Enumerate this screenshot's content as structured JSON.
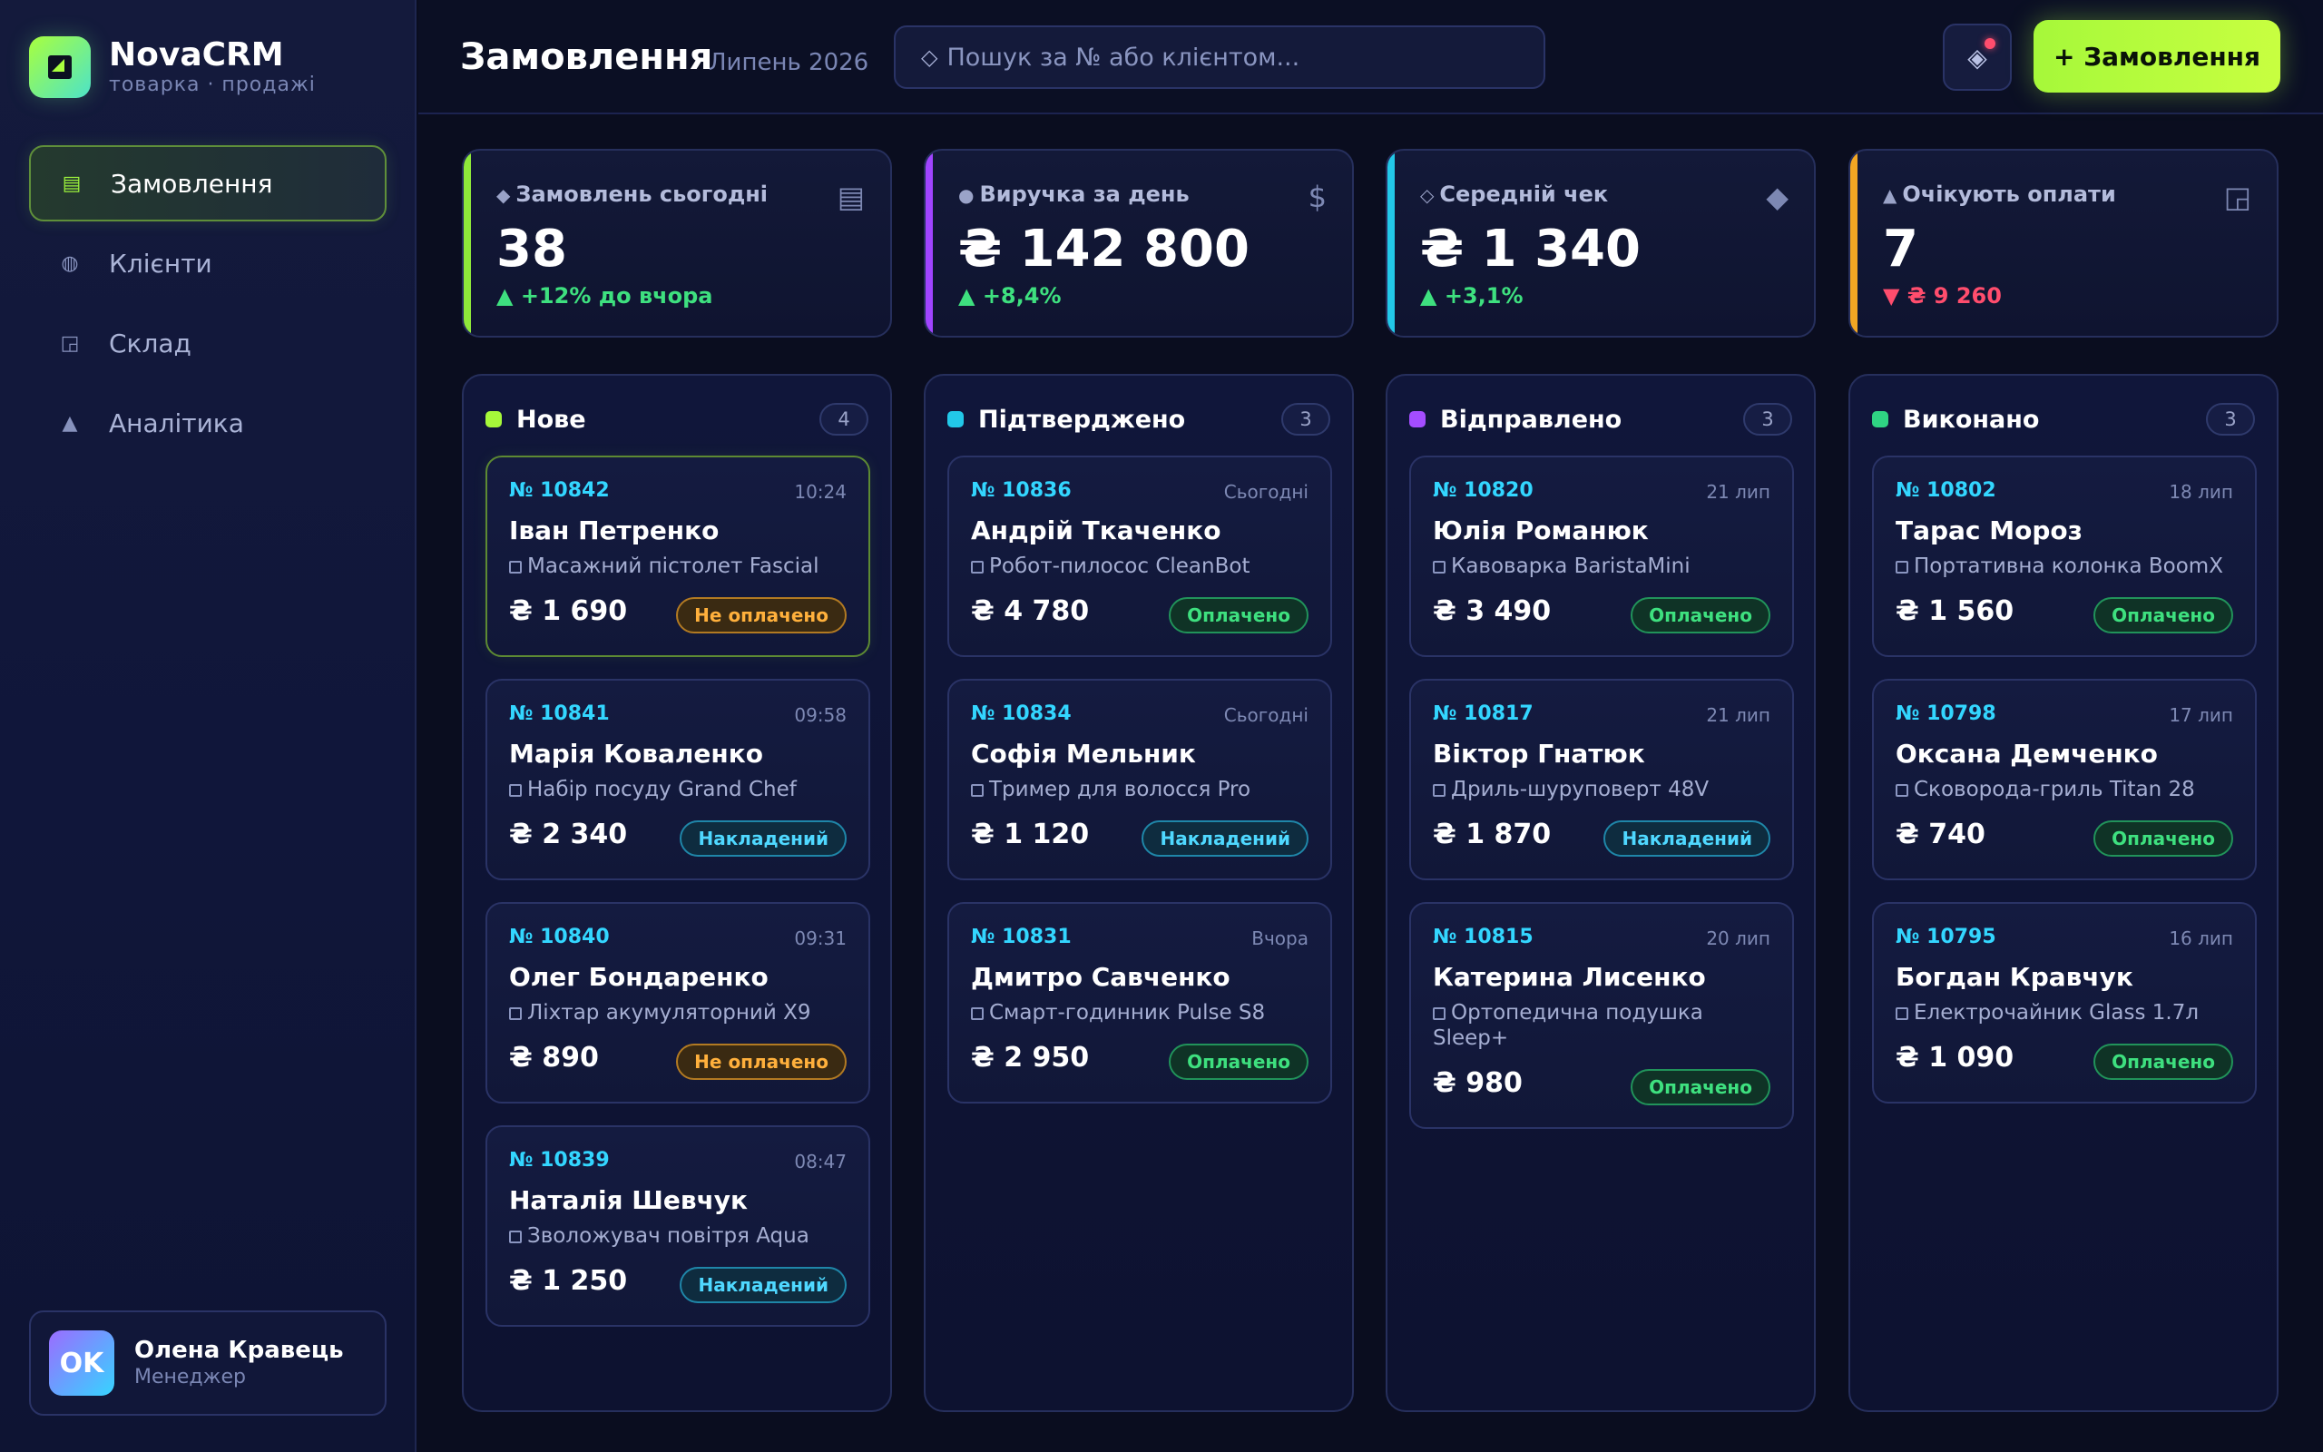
{
  "brand": {
    "name": "NovaCRM",
    "subtitle": "товарка · продажі"
  },
  "nav": [
    {
      "label": "Замовлення",
      "icon": "orders-list-icon",
      "active": true
    },
    {
      "label": "Клієнти",
      "icon": "clients-icon",
      "active": false
    },
    {
      "label": "Склад",
      "icon": "warehouse-icon",
      "active": false
    },
    {
      "label": "Аналітика",
      "icon": "analytics-icon",
      "active": false
    }
  ],
  "user": {
    "initials": "OK",
    "name": "Олена Кравець",
    "role": "Менеджер"
  },
  "header": {
    "title": "Замовлення",
    "period": "Липень 2026",
    "search_placeholder": "Пошук за № або клієнтом...",
    "new_order_label": "+ Замовлення"
  },
  "stats": [
    {
      "label": "Замовлень сьогодні",
      "value": "38",
      "delta": "▲ +12% до вчора",
      "trend": "up",
      "accent": "#8ee83a",
      "icon": "orders-icon"
    },
    {
      "label": "Виручка за день",
      "value": "₴ 142 800",
      "delta": "▲ +8,4%",
      "trend": "up",
      "accent": "#a044ff",
      "icon": "dollar-icon"
    },
    {
      "label": "Середній чек",
      "value": "₴ 1 340",
      "delta": "▲ +3,1%",
      "trend": "up",
      "accent": "#22c8e8",
      "icon": "diamond-icon"
    },
    {
      "label": "Очікують оплати",
      "value": "7",
      "delta": "▼ ₴ 9 260",
      "trend": "down",
      "accent": "#f2a623",
      "icon": "pending-icon"
    }
  ],
  "columns": [
    {
      "title": "Нове",
      "count": "4",
      "color": "#a6f83a",
      "cards": [
        {
          "number": "№ 10842",
          "time": "10:24",
          "name": "Іван Петренко",
          "product": "Масажний пістолет Fascial",
          "price": "₴ 1 690",
          "status": "Не оплачено",
          "status_type": "unpaid"
        },
        {
          "number": "№ 10841",
          "time": "09:58",
          "name": "Марія Коваленко",
          "product": "Набір посуду Grand Chef",
          "price": "₴ 2 340",
          "status": "Накладений",
          "status_type": "cod"
        },
        {
          "number": "№ 10840",
          "time": "09:31",
          "name": "Олег Бондаренко",
          "product": "Ліхтар акумуляторний X9",
          "price": "₴ 890",
          "status": "Не оплачено",
          "status_type": "unpaid"
        },
        {
          "number": "№ 10839",
          "time": "08:47",
          "name": "Наталія Шевчук",
          "product": "Зволожувач повітря Aqua",
          "price": "₴ 1 250",
          "status": "Накладений",
          "status_type": "cod"
        }
      ]
    },
    {
      "title": "Підтверджено",
      "count": "3",
      "color": "#22c8e8",
      "cards": [
        {
          "number": "№ 10836",
          "time": "Сьогодні",
          "name": "Андрій Ткаченко",
          "product": "Робот-пилосос CleanBot",
          "price": "₴ 4 780",
          "status": "Оплачено",
          "status_type": "paid"
        },
        {
          "number": "№ 10834",
          "time": "Сьогодні",
          "name": "Софія Мельник",
          "product": "Тример для волосся Pro",
          "price": "₴ 1 120",
          "status": "Накладений",
          "status_type": "cod"
        },
        {
          "number": "№ 10831",
          "time": "Вчора",
          "name": "Дмитро Савченко",
          "product": "Смарт-годинник Pulse S8",
          "price": "₴ 2 950",
          "status": "Оплачено",
          "status_type": "paid"
        }
      ]
    },
    {
      "title": "Відправлено",
      "count": "3",
      "color": "#a44dff",
      "cards": [
        {
          "number": "№ 10820",
          "time": "21 лип",
          "name": "Юлія Романюк",
          "product": "Кавоварка BaristaMini",
          "price": "₴ 3 490",
          "status": "Оплачено",
          "status_type": "paid"
        },
        {
          "number": "№ 10817",
          "time": "21 лип",
          "name": "Віктор Гнатюк",
          "product": "Дриль-шуруповерт 48V",
          "price": "₴ 1 870",
          "status": "Накладений",
          "status_type": "cod"
        },
        {
          "number": "№ 10815",
          "time": "20 лип",
          "name": "Катерина Лисенко",
          "product": "Ортопедична подушка Sleep+",
          "price": "₴ 980",
          "status": "Оплачено",
          "status_type": "paid"
        }
      ]
    },
    {
      "title": "Виконано",
      "count": "3",
      "color": "#2fd483",
      "cards": [
        {
          "number": "№ 10802",
          "time": "18 лип",
          "name": "Тарас Мороз",
          "product": "Портативна колонка BoomX",
          "price": "₴ 1 560",
          "status": "Оплачено",
          "status_type": "paid"
        },
        {
          "number": "№ 10798",
          "time": "17 лип",
          "name": "Оксана Демченко",
          "product": "Сковорода-гриль Titan 28",
          "price": "₴ 740",
          "status": "Оплачено",
          "status_type": "paid"
        },
        {
          "number": "№ 10795",
          "time": "16 лип",
          "name": "Богдан Кравчук",
          "product": "Електрочайник Glass 1.7л",
          "price": "₴ 1 090",
          "status": "Оплачено",
          "status_type": "paid"
        }
      ]
    }
  ]
}
